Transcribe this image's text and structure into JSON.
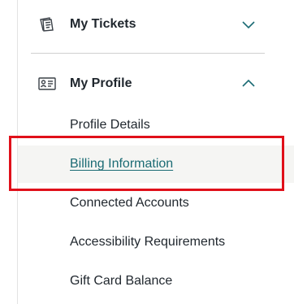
{
  "nav": {
    "tickets": {
      "label": "My Tickets",
      "icon": "tickets-icon",
      "state": "collapsed"
    },
    "profile": {
      "label": "My Profile",
      "icon": "profile-card-icon",
      "state": "expanded",
      "items": [
        {
          "label": "Profile Details"
        },
        {
          "label": "Billing Information",
          "active": true
        },
        {
          "label": "Connected Accounts"
        },
        {
          "label": "Accessibility Requirements"
        },
        {
          "label": "Gift Card Balance"
        }
      ]
    }
  },
  "colors": {
    "accent": "#1b6b74",
    "highlight": "#e0101a",
    "text": "#1f262d",
    "active_bg": "#f5f5f3"
  }
}
